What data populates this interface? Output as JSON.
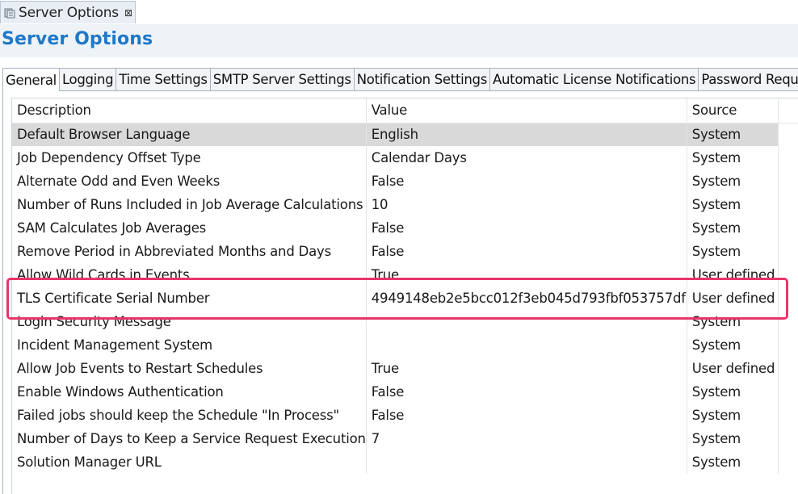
{
  "editor_tab": {
    "label": "Server Options",
    "icon": "server-options-icon",
    "close": "⊠"
  },
  "header": {
    "title": "Server Options",
    "title_color": "#1f78c8"
  },
  "tabs": [
    {
      "label": "General",
      "active": true
    },
    {
      "label": "Logging"
    },
    {
      "label": "Time Settings"
    },
    {
      "label": "SMTP Server Settings"
    },
    {
      "label": "Notification Settings"
    },
    {
      "label": "Automatic License Notifications"
    },
    {
      "label": "Password Requi"
    }
  ],
  "table": {
    "columns": [
      "Description",
      "Value",
      "Source"
    ],
    "rows": [
      [
        "Default Browser Language",
        "English",
        "System"
      ],
      [
        "Job Dependency Offset Type",
        "Calendar Days",
        "System"
      ],
      [
        "Alternate Odd and Even Weeks",
        "False",
        "System"
      ],
      [
        "Number of Runs Included in Job Average Calculations",
        "10",
        "System"
      ],
      [
        "SAM Calculates Job Averages",
        "False",
        "System"
      ],
      [
        "Remove Period in Abbreviated Months and Days",
        "False",
        "System"
      ],
      [
        "Allow Wild Cards in Events",
        "True",
        "User defined"
      ],
      [
        "TLS Certificate Serial Number",
        "4949148eb2e5bcc012f3eb045d793fbf053757df",
        "User defined"
      ],
      [
        "Login Security Message",
        "",
        "System"
      ],
      [
        "Incident Management System",
        "",
        "System"
      ],
      [
        "Allow Job Events to Restart Schedules",
        "True",
        "User defined"
      ],
      [
        "Enable Windows Authentication",
        "False",
        "System"
      ],
      [
        "Failed jobs should keep the Schedule \"In Process\"",
        "False",
        "System"
      ],
      [
        "Number of Days to Keep a Service Request Execution",
        "7",
        "System"
      ],
      [
        "Solution Manager URL",
        "",
        "System"
      ]
    ],
    "selected_row": 0,
    "highlighted_row": 7
  },
  "colors": {
    "highlight": "#e8366a",
    "selected_row": "#d9d9d9"
  }
}
